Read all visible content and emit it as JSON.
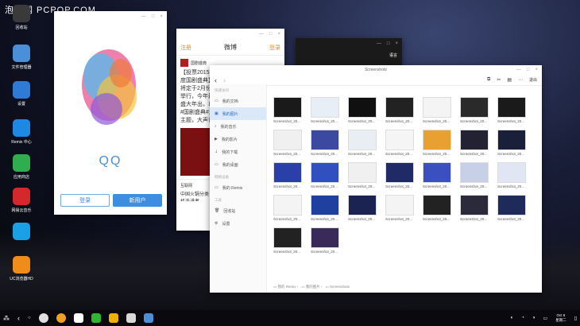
{
  "watermark": "泡泡网 PCPOP.COM",
  "desktop": [
    {
      "label": "回收站",
      "icon": "trash-icon",
      "color": "#3a3a3a"
    },
    {
      "label": "文件管理器",
      "icon": "folder-icon",
      "color": "#4a90d9"
    },
    {
      "label": "设置",
      "icon": "settings-icon",
      "color": "#2d7bd4"
    },
    {
      "label": "Remix 中心",
      "icon": "remix-icon",
      "color": "#1e88e5"
    },
    {
      "label": "应用商店",
      "icon": "store-icon",
      "color": "#2eae4e"
    },
    {
      "label": "网易云音乐",
      "icon": "music-icon",
      "color": "#d4282d"
    },
    {
      "label": "",
      "icon": "search-icon",
      "color": "#19a0e6"
    },
    {
      "label": "UC浏览器HD",
      "icon": "uc-browser-icon",
      "color": "#f08c1a"
    }
  ],
  "qq": {
    "title": "QQ",
    "login": "登录",
    "new_user": "新用户"
  },
  "weibo": {
    "left": "注册",
    "title": "微博",
    "right": "登录",
    "author": "国剧盛典",
    "text": "【投票2015年度国剧盛典】将定于2月份举行，今年最盛大年出，以#国剧盛典#为主题，大声说出你最爱。《国剧盛典》证书颁发奖的...",
    "author2": "互联网",
    "text2": "中国火锅分类 买机选进者..."
  },
  "dark_window": {
    "text": "语言"
  },
  "fm": {
    "title": "Screenshots",
    "exit": "退出",
    "sec1": "快速访问",
    "items": [
      "我的文档",
      "我的图片",
      "我的音乐",
      "我的影片",
      "我的下载",
      "我的桌面"
    ],
    "sec2": "网络设备",
    "remix": "我的 Remix",
    "sec3": "工具",
    "trash": "回收站",
    "settings": "设置",
    "breadcrumb": [
      "我的 Remix",
      "我的图片",
      "Screenshots"
    ],
    "file_label": "Screenshot_20..."
  },
  "taskbar": {
    "time": "Oct 8",
    "date": "星期二"
  }
}
